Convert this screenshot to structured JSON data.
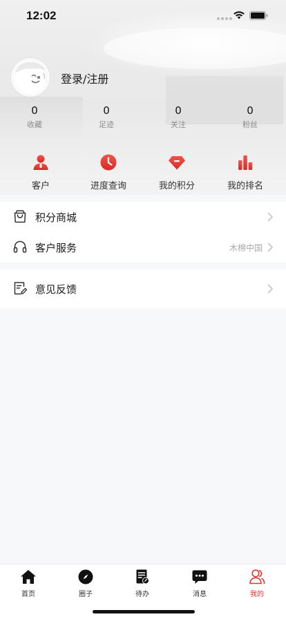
{
  "status_bar": {
    "time": "12:02"
  },
  "profile": {
    "login_label": "登录/注册"
  },
  "stats": [
    {
      "value": "0",
      "label": "收藏"
    },
    {
      "value": "0",
      "label": "足迹"
    },
    {
      "value": "0",
      "label": "关注"
    },
    {
      "value": "0",
      "label": "粉丝"
    }
  ],
  "quick_actions": [
    {
      "label": "客户",
      "icon": "customer-icon"
    },
    {
      "label": "进度查询",
      "icon": "clock-icon"
    },
    {
      "label": "我的积分",
      "icon": "diamond-icon"
    },
    {
      "label": "我的排名",
      "icon": "bar-chart-icon"
    }
  ],
  "menu": {
    "group1": [
      {
        "label": "积分商城",
        "value": "",
        "icon": "shopping-bag-icon"
      },
      {
        "label": "客户服务",
        "value": "木棉中国",
        "icon": "headphones-icon"
      }
    ],
    "group2": [
      {
        "label": "意见反馈",
        "value": "",
        "icon": "feedback-icon"
      }
    ]
  },
  "tabs": [
    {
      "label": "首页",
      "icon": "home-icon",
      "active": false
    },
    {
      "label": "圈子",
      "icon": "compass-icon",
      "active": false
    },
    {
      "label": "待办",
      "icon": "todo-icon",
      "active": false
    },
    {
      "label": "消息",
      "icon": "message-icon",
      "active": false
    },
    {
      "label": "我的",
      "icon": "user-icon",
      "active": true
    }
  ],
  "colors": {
    "accent": "#e0342f",
    "background": "#f7f8fa"
  }
}
